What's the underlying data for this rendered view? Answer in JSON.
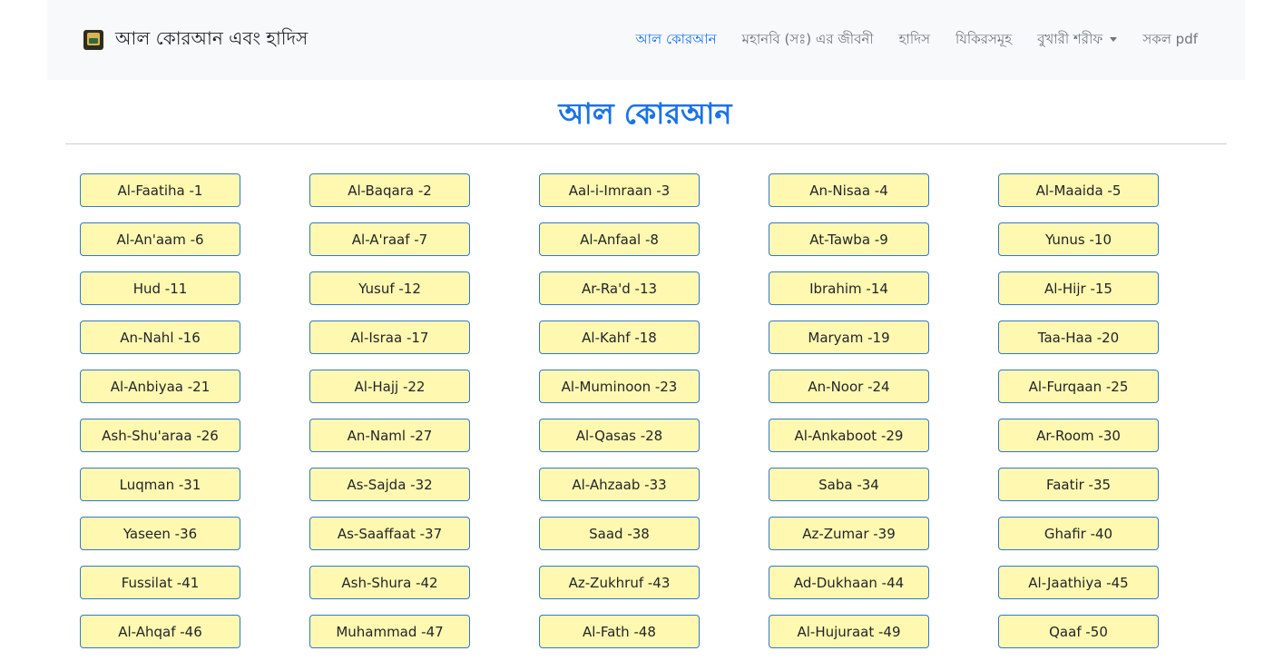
{
  "navbar": {
    "brand_title": "আল কোরআন এবং হাদিস",
    "links": [
      {
        "label": "আল কোরআন",
        "active": true
      },
      {
        "label": "মহানবি (সঃ) এর জীবনী",
        "active": false
      },
      {
        "label": "হাদিস",
        "active": false
      },
      {
        "label": "যিকিরসমূহ",
        "active": false
      },
      {
        "label": "বুখারী শরীফ",
        "active": false,
        "dropdown": true
      },
      {
        "label": "সকল pdf",
        "active": false
      }
    ]
  },
  "main": {
    "title": "আল কোরআন",
    "surahs": [
      "Al-Faatiha -1",
      "Al-Baqara -2",
      "Aal-i-Imraan -3",
      "An-Nisaa -4",
      "Al-Maaida -5",
      "Al-An'aam -6",
      "Al-A'raaf -7",
      "Al-Anfaal -8",
      "At-Tawba -9",
      "Yunus -10",
      "Hud -11",
      "Yusuf -12",
      "Ar-Ra'd -13",
      "Ibrahim -14",
      "Al-Hijr -15",
      "An-Nahl -16",
      "Al-Israa -17",
      "Al-Kahf -18",
      "Maryam -19",
      "Taa-Haa -20",
      "Al-Anbiyaa -21",
      "Al-Hajj -22",
      "Al-Muminoon -23",
      "An-Noor -24",
      "Al-Furqaan -25",
      "Ash-Shu'araa -26",
      "An-Naml -27",
      "Al-Qasas -28",
      "Al-Ankaboot -29",
      "Ar-Room -30",
      "Luqman -31",
      "As-Sajda -32",
      "Al-Ahzaab -33",
      "Saba -34",
      "Faatir -35",
      "Yaseen -36",
      "As-Saaffaat -37",
      "Saad -38",
      "Az-Zumar -39",
      "Ghafir -40",
      "Fussilat -41",
      "Ash-Shura -42",
      "Az-Zukhruf -43",
      "Ad-Dukhaan -44",
      "Al-Jaathiya -45",
      "Al-Ahqaf -46",
      "Muhammad -47",
      "Al-Fath -48",
      "Al-Hujuraat -49",
      "Qaaf -50"
    ]
  },
  "colors": {
    "accent": "#0d6efd",
    "title": "#1a73e8",
    "button_bg": "#fff8b0",
    "button_border": "#3377cc"
  }
}
